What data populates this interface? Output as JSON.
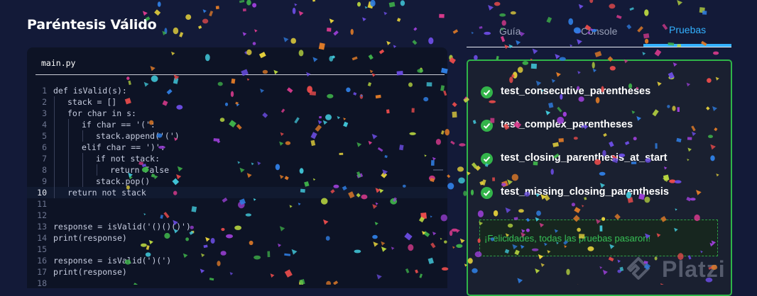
{
  "page_title": "Paréntesis Válido",
  "editor": {
    "file_name": "main.py",
    "lines": [
      {
        "n": "1",
        "code": "def isValid(s):",
        "indent": 0
      },
      {
        "n": "2",
        "code": "stack = []",
        "indent": 1
      },
      {
        "n": "3",
        "code": "for char in s:",
        "indent": 1
      },
      {
        "n": "4",
        "code": "if char == '(':",
        "indent": 2
      },
      {
        "n": "5",
        "code": "stack.append('(')",
        "indent": 3
      },
      {
        "n": "6",
        "code": "elif char == ')':",
        "indent": 2
      },
      {
        "n": "7",
        "code": "if not stack:",
        "indent": 3
      },
      {
        "n": "8",
        "code": "return False",
        "indent": 4
      },
      {
        "n": "9",
        "code": "stack.pop()",
        "indent": 3
      },
      {
        "n": "10",
        "code": "return not stack",
        "indent": 1,
        "active": true
      },
      {
        "n": "11",
        "code": "",
        "indent": 0
      },
      {
        "n": "12",
        "code": "",
        "indent": 0
      },
      {
        "n": "13",
        "code": "response = isValid('()()()')",
        "indent": 0
      },
      {
        "n": "14",
        "code": "print(response)",
        "indent": 0
      },
      {
        "n": "15",
        "code": "",
        "indent": 0
      },
      {
        "n": "16",
        "code": "response = isValid(')(')",
        "indent": 0
      },
      {
        "n": "17",
        "code": "print(response)",
        "indent": 0
      },
      {
        "n": "18",
        "code": "",
        "indent": 0
      }
    ]
  },
  "tabs": {
    "guide": "Guía",
    "console": "Console",
    "tests": "Pruebas"
  },
  "results": {
    "tests": [
      "test_consecutive_parentheses",
      "test_complex_parentheses",
      "test_closing_parenthesis_at_start",
      "test_missing_closing_parenthesis"
    ],
    "success_message": "¡Felicidades, todas las pruebas pasaron!"
  },
  "watermark": {
    "icon": "platzi-logo-icon",
    "text": "Platzi"
  },
  "colors": {
    "background": "#131a38",
    "editor_bg": "#0d1325",
    "accent": "#33b1ff",
    "success": "#2fb449"
  }
}
